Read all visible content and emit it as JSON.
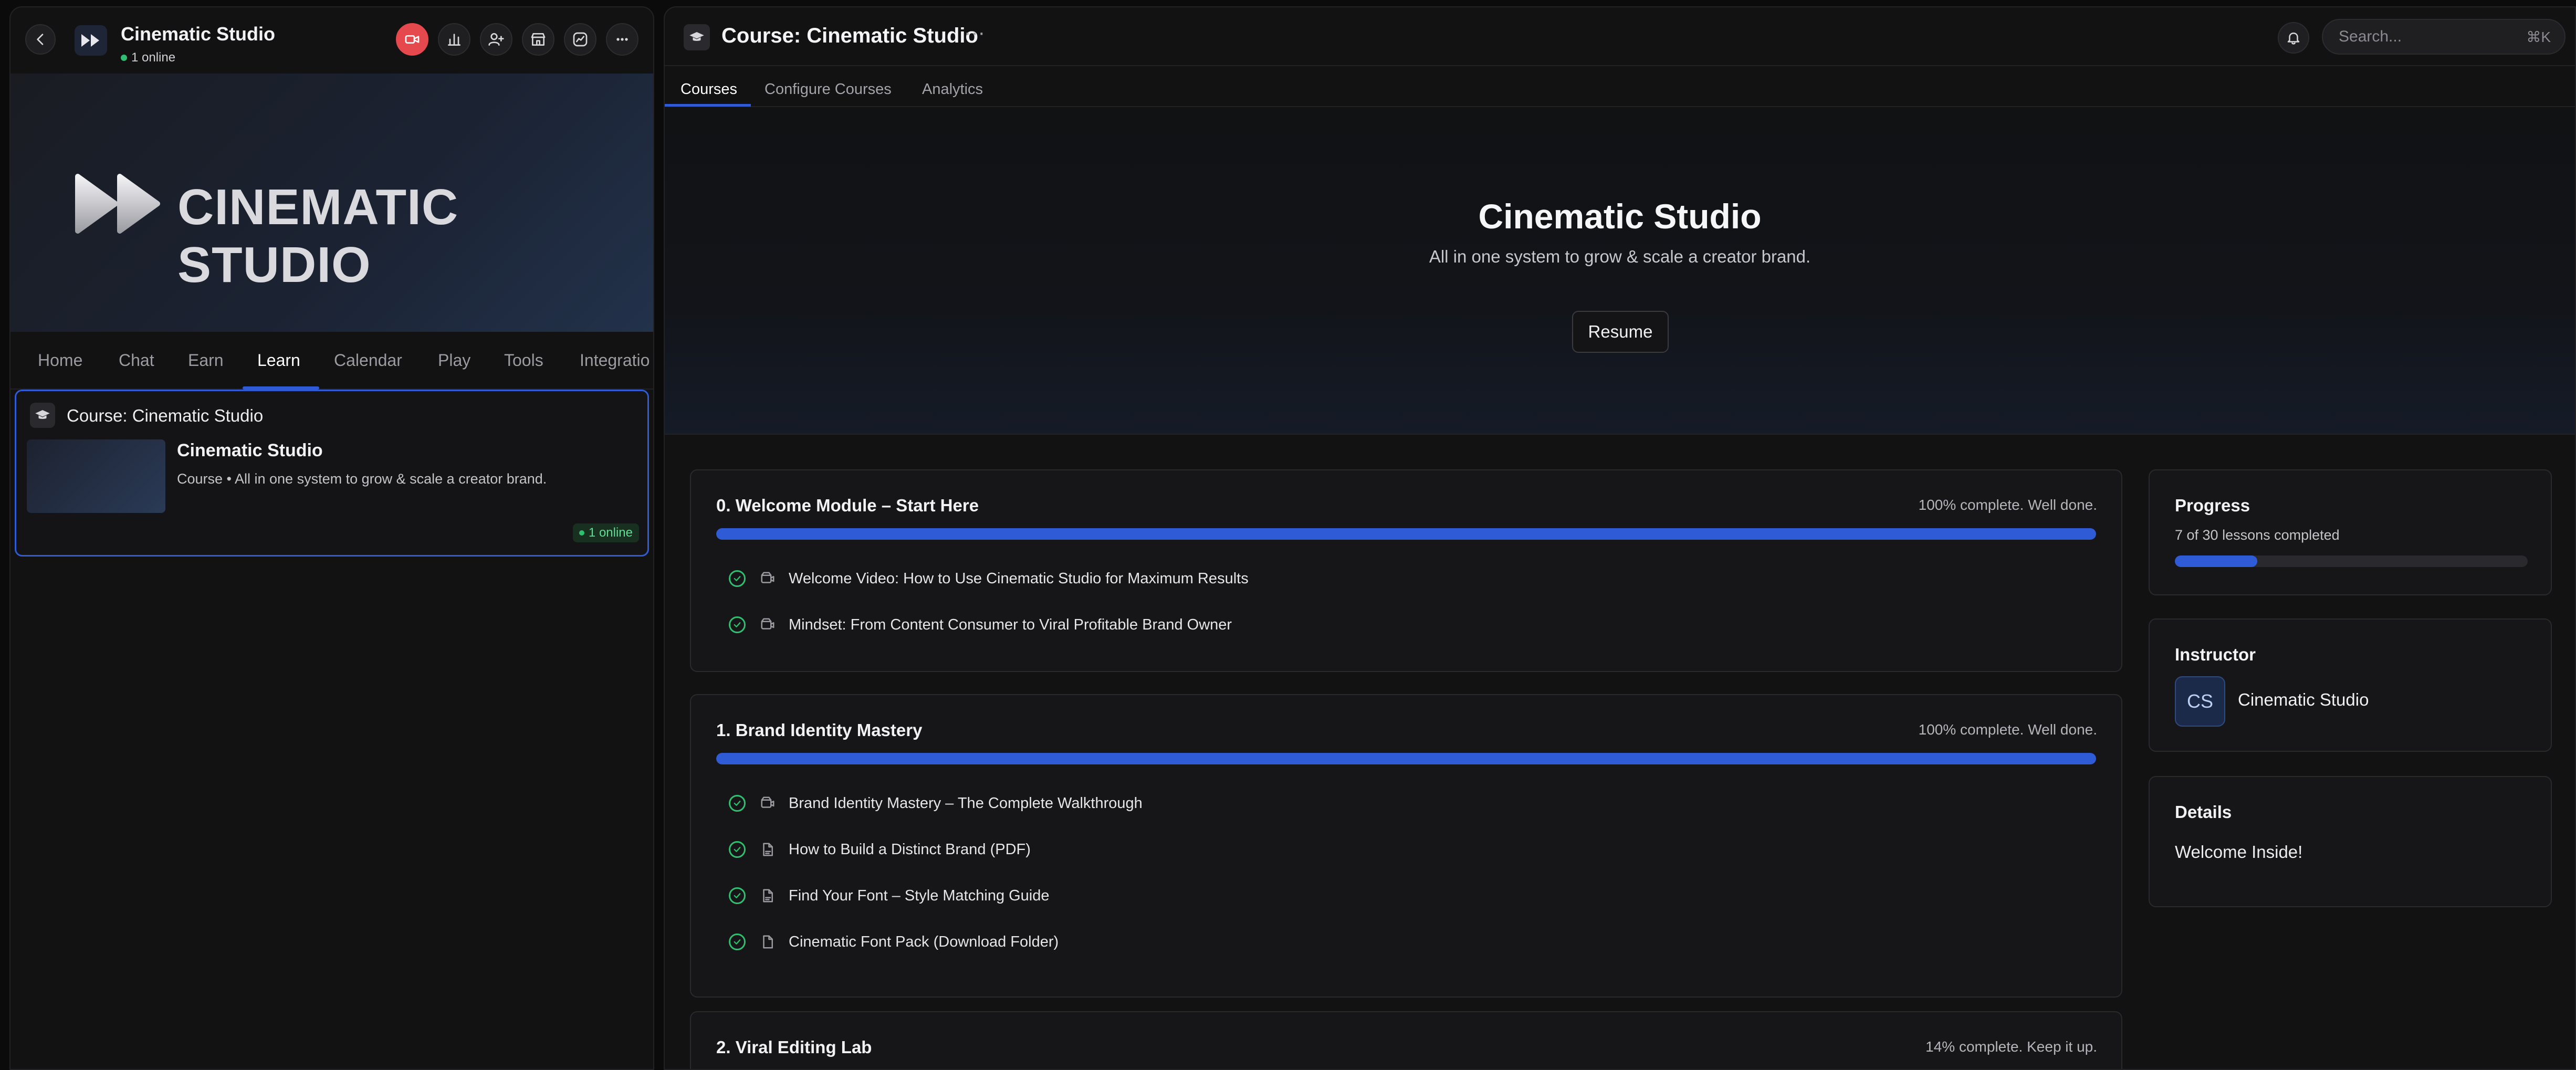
{
  "channel": {
    "title": "Cinematic Studio",
    "online": "1 online"
  },
  "banner": {
    "title": "CINEMATIC STUDIO"
  },
  "left_tabs": [
    "Home",
    "Chat",
    "Earn",
    "Learn",
    "Calendar",
    "Play",
    "Tools",
    "Integratio"
  ],
  "left_active_tab": "Learn",
  "course_card": {
    "header": "Course: Cinematic Studio",
    "title": "Cinematic Studio",
    "subtitle": "Course • All in one system to grow & scale a creator brand.",
    "badge": "1 online"
  },
  "header": {
    "title": "Course: Cinematic Studio",
    "more": "···"
  },
  "search": {
    "placeholder": "Search...",
    "shortcut": "⌘K"
  },
  "tabs": [
    "Courses",
    "Configure Courses",
    "Analytics"
  ],
  "active_tab": "Courses",
  "hero": {
    "title": "Cinematic Studio",
    "subtitle": "All in one system to grow & scale a creator brand.",
    "resume_label": "Resume"
  },
  "modules": [
    {
      "title": "0. Welcome Module – Start Here",
      "status": "100% complete. Well done.",
      "progress": 1.0,
      "lessons": [
        {
          "label": "Welcome Video: How to Use Cinematic Studio for Maximum Results",
          "type": "video-icon"
        },
        {
          "label": "Mindset: From Content Consumer to Viral Profitable Brand Owner",
          "type": "video-icon"
        }
      ]
    },
    {
      "title": "1. Brand Identity Mastery",
      "status": "100% complete. Well done.",
      "progress": 1.0,
      "lessons": [
        {
          "label": "Brand Identity Mastery – The Complete Walkthrough",
          "type": "video-icon"
        },
        {
          "label": "How to Build a Distinct Brand (PDF)",
          "type": "pdf-icon"
        },
        {
          "label": "Find Your Font – Style Matching Guide",
          "type": "pdf-icon"
        },
        {
          "label": "Cinematic Font Pack (Download Folder)",
          "type": "file-icon"
        }
      ]
    },
    {
      "title": "2. Viral Editing Lab",
      "status": "14% complete. Keep it up.",
      "progress": 0.14,
      "lessons": []
    }
  ],
  "progress_card": {
    "title": "Progress",
    "text": "7 of 30 lessons completed",
    "fraction": 0.233
  },
  "instructor_card": {
    "title": "Instructor",
    "initials": "CS",
    "name": "Cinematic Studio"
  },
  "details_card": {
    "title": "Details",
    "text": "Welcome Inside!"
  },
  "colors": {
    "accent": "#2f5bd6",
    "success": "#2fbf71",
    "record": "#e5484d",
    "background": "#121213"
  }
}
